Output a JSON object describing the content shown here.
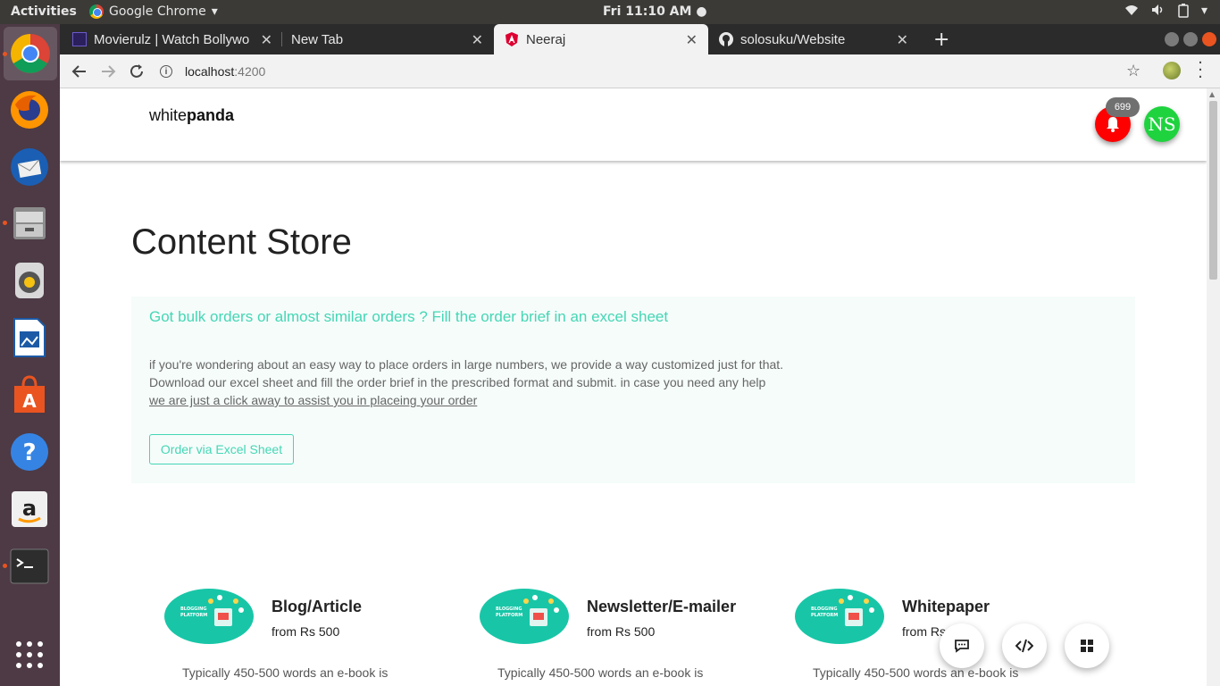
{
  "system": {
    "activities": "Activities",
    "app_menu": "Google Chrome",
    "clock": "Fri 11:10 AM"
  },
  "dock": {
    "items": [
      "chrome-icon",
      "firefox-icon",
      "thunderbird-icon",
      "files-icon",
      "rhythmbox-icon",
      "writer-icon",
      "software-icon",
      "help-icon",
      "amazon-icon",
      "terminal-icon",
      "app-grid-icon"
    ],
    "help_glyph": "?"
  },
  "browser": {
    "tabs": [
      {
        "title": "Movierulz | Watch Bollywo",
        "active": false
      },
      {
        "title": "New Tab",
        "active": false
      },
      {
        "title": "Neeraj",
        "active": true
      },
      {
        "title": "solosuku/Website",
        "active": false
      }
    ],
    "close_glyph": "✕",
    "new_tab_glyph": "+",
    "url_host": "localhost",
    "url_port": ":4200"
  },
  "page": {
    "brand_light": "white",
    "brand_bold": "panda",
    "notification_count": "699",
    "avatar_initials": "NS",
    "title": "Content Store",
    "bulk": {
      "title": "Got bulk orders or almost similar orders ? Fill the order brief in an excel sheet",
      "line1": "if you're wondering about an easy way to place orders in large numbers, we provide a way customized just for that.",
      "line2": "Download our excel sheet and fill the order brief in the prescribed format and submit. in case you need any help",
      "link": "we are just a click away to assist you in placeing your order",
      "button": "Order via Excel Sheet"
    },
    "cards": [
      {
        "name": "Blog/Article",
        "price": "from Rs 500",
        "desc": "Typically 450-500 words an e-book is"
      },
      {
        "name": "Newsletter/E-mailer",
        "price": "from Rs 500",
        "desc": "Typically 450-500 words an e-book is"
      },
      {
        "name": "Whitepaper",
        "price": "from Rs 500",
        "desc": "Typically 450-500 words an e-book is"
      }
    ],
    "thumbnail_text": "BLOGGING PLATFORM",
    "fabs": [
      "chat-icon",
      "code-icon",
      "grid-icon"
    ]
  },
  "colors": {
    "accent": "#45d6b5",
    "notification": "#ff0000",
    "avatar": "#1fd33f"
  }
}
